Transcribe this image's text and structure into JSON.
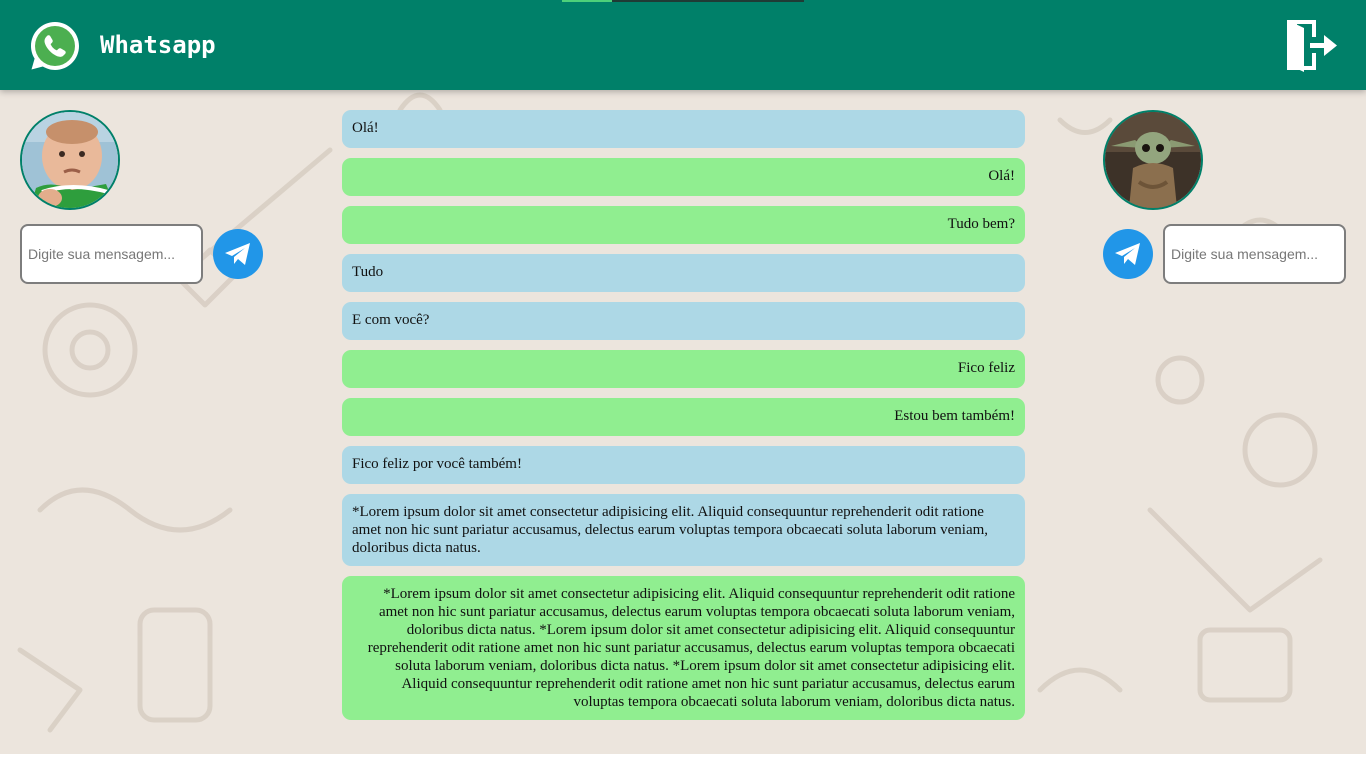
{
  "header": {
    "title": "Whatsapp",
    "logo_icon": "whatsapp-logo-icon",
    "logout_icon": "logout-icon",
    "color": "#008069"
  },
  "left_user": {
    "input_placeholder": "Digite sua mensagem...",
    "send_icon": "paper-plane-icon"
  },
  "right_user": {
    "input_placeholder": "Digite sua mensagem...",
    "send_icon": "paper-plane-icon"
  },
  "colors": {
    "received_bubble": "#add8e6",
    "sent_bubble": "#90ee90",
    "send_button": "#2196e8"
  },
  "messages": [
    {
      "side": "recv",
      "text": "Olá!"
    },
    {
      "side": "sent",
      "text": "Olá!"
    },
    {
      "side": "sent",
      "text": "Tudo bem?"
    },
    {
      "side": "recv",
      "text": "Tudo"
    },
    {
      "side": "recv",
      "text": "E com você?"
    },
    {
      "side": "sent",
      "text": "Fico feliz"
    },
    {
      "side": "sent",
      "text": "Estou bem também!"
    },
    {
      "side": "recv",
      "text": "Fico feliz por você também!"
    },
    {
      "side": "recv",
      "text": "*Lorem ipsum dolor sit amet consectetur adipisicing elit. Aliquid consequuntur reprehenderit odit ratione amet non hic sunt pariatur accusamus, delectus earum voluptas tempora obcaecati soluta laborum veniam, doloribus dicta natus."
    },
    {
      "side": "sent",
      "text": "*Lorem ipsum dolor sit amet consectetur adipisicing elit. Aliquid consequuntur reprehenderit odit ratione amet non hic sunt pariatur accusamus, delectus earum voluptas tempora obcaecati soluta laborum veniam, doloribus dicta natus. *Lorem ipsum dolor sit amet consectetur adipisicing elit. Aliquid consequuntur reprehenderit odit ratione amet non hic sunt pariatur accusamus, delectus earum voluptas tempora obcaecati soluta laborum veniam, doloribus dicta natus. *Lorem ipsum dolor sit amet consectetur adipisicing elit. Aliquid consequuntur reprehenderit odit ratione amet non hic sunt pariatur accusamus, delectus earum voluptas tempora obcaecati soluta laborum veniam, doloribus dicta natus."
    }
  ]
}
